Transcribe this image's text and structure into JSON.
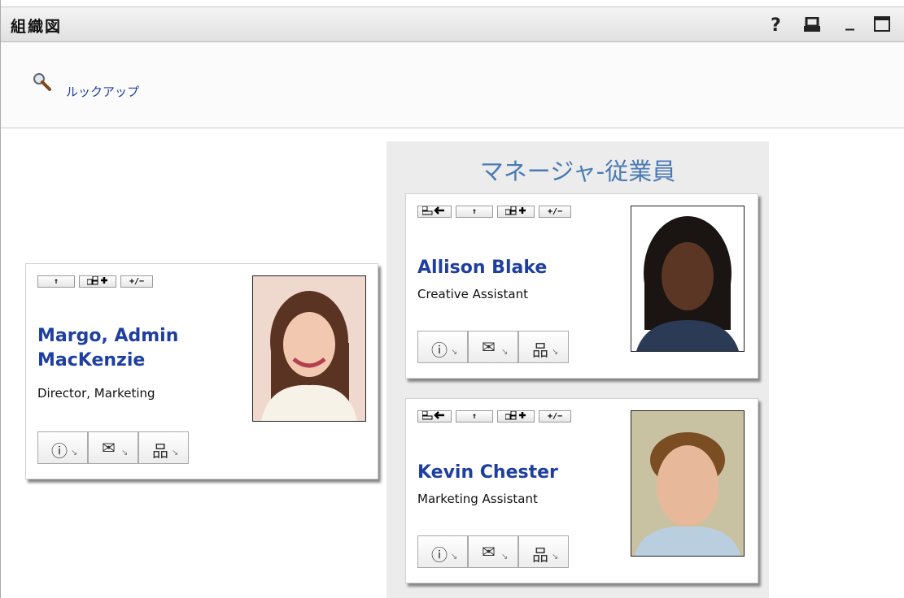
{
  "window": {
    "title": "組織図",
    "help_label": "?",
    "minimize_label": "_"
  },
  "toolbar": {
    "lookup_label": "ルックアップ"
  },
  "managers_panel": {
    "title": "マネージャ-従業員"
  },
  "card_buttons": {
    "to_manager": "↑",
    "expand": "+/−"
  },
  "people": [
    {
      "name_line1": "Margo, Admin",
      "name_line2": "MacKenzie",
      "title": "Director, Marketing",
      "photo": "woman-brown-hair"
    },
    {
      "name_line1": "Allison Blake",
      "title": "Creative Assistant",
      "photo": "woman-dark-hair"
    },
    {
      "name_line1": "Kevin Chester",
      "title": "Marketing Assistant",
      "photo": "man-brown-hair"
    }
  ],
  "icons": {
    "info": "info-icon",
    "email": "email-icon",
    "orgchart": "org-chart-icon"
  }
}
